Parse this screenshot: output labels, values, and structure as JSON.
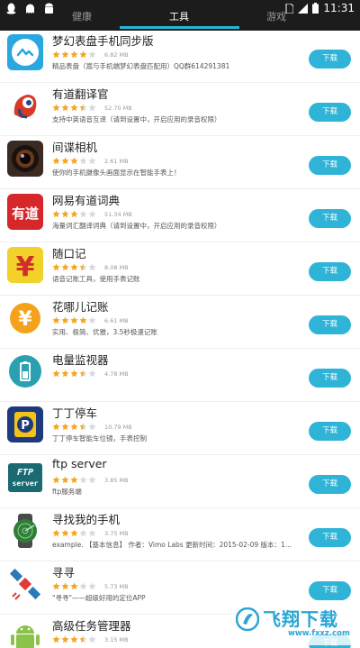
{
  "status_bar": {
    "time": "11:31"
  },
  "tabs": [
    {
      "label": "健康"
    },
    {
      "label": "工具"
    },
    {
      "label": "游戏"
    }
  ],
  "download_label": "下载",
  "apps": [
    {
      "name": "梦幻表盘手机同步版",
      "rating": 4,
      "size": "6.82 MB",
      "desc": "精品表盘（嵩与手机端梦幻表盘匹配用）QQ群614291381",
      "icon": "dream-dial-icon"
    },
    {
      "name": "有道翻译官",
      "rating": 3.5,
      "size": "52.70 MB",
      "desc": "支持中英语音互译（请到设置中，开启应用的录音权限）",
      "icon": "youdao-translator-icon"
    },
    {
      "name": "间谍相机",
      "rating": 3,
      "size": "2.61 MB",
      "desc": "使你的手机摄像头画面显示在智能手表上！",
      "icon": "spy-camera-icon"
    },
    {
      "name": "网易有道词典",
      "rating": 3,
      "size": "51.34 MB",
      "desc": "海量词汇翻译词典（请到设置中，开启应用的录音权限）",
      "icon": "youdao-dictionary-icon"
    },
    {
      "name": "随口记",
      "rating": 3.5,
      "size": "8.08 MB",
      "desc": "语音记账工具，使用手表记账",
      "icon": "yen-note-icon"
    },
    {
      "name": "花哪儿记账",
      "rating": 4,
      "size": "6.61 MB",
      "desc": "实用、极简、优雅，3.5秒极速记账",
      "icon": "huanaer-icon"
    },
    {
      "name": "电量监视器",
      "rating": 3.5,
      "size": "4.78 MB",
      "desc": "",
      "icon": "battery-monitor-icon"
    },
    {
      "name": "丁丁停车",
      "rating": 3.5,
      "size": "10.79 MB",
      "desc": "丁丁停车智能车位镜，手表控制",
      "icon": "dingding-parking-icon"
    },
    {
      "name": "ftp server",
      "rating": 3,
      "size": "3.85 MB",
      "desc": "ftp服务端",
      "icon": "ftp-server-icon"
    },
    {
      "name": "寻找我的手机",
      "rating": 3,
      "size": "3.75 MB",
      "desc": "example.  【基本信息】 作者：Vimo Labs 更新时间：2015-02-09 版本：1...",
      "icon": "find-phone-icon"
    },
    {
      "name": "寻寻",
      "rating": 3,
      "size": "5.73 MB",
      "desc": "\"寻寻\"——超级好用的定位APP",
      "icon": "xunxun-icon"
    },
    {
      "name": "高级任务管理器",
      "rating": 3.5,
      "size": "3.15 MB",
      "desc": "",
      "icon": "android-task-icon"
    }
  ],
  "watermark": {
    "text": "飞翔下载",
    "url": "www.fxxz.com"
  },
  "colors": {
    "accent": "#2fb4d8",
    "star": "#f5a623",
    "statusbar": "#1c1c1c"
  }
}
